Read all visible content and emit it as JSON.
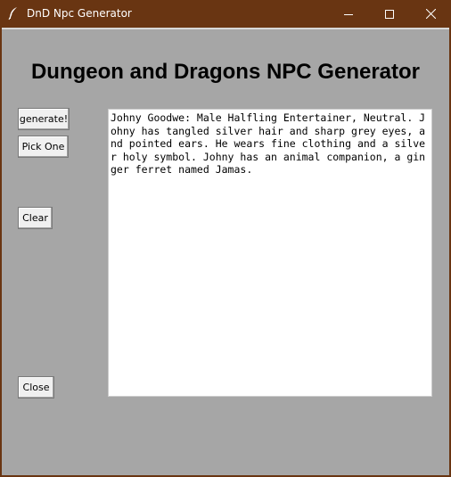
{
  "window": {
    "title": "DnD Npc Generator",
    "icon": "feather-icon",
    "controls": {
      "minimize": "minimize-icon",
      "maximize": "maximize-icon",
      "close": "close-icon"
    }
  },
  "header": {
    "title": "Dungeon and Dragons NPC Generator"
  },
  "buttons": {
    "generate": "generate!",
    "pick_one": "Pick One",
    "clear": "Clear",
    "close": "Close"
  },
  "output": {
    "text": "Johny Goodwe: Male Halfling Entertainer, Neutral. Johny has tangled silver hair and sharp grey eyes, and pointed ears. He wears fine clothing and a silver holy symbol. Johny has an animal companion, a ginger ferret named Jamas."
  },
  "colors": {
    "titlebar": "#693512",
    "client_bg": "#a6a6a6",
    "button_bg": "#f0f0f0",
    "text_bg": "#ffffff"
  }
}
